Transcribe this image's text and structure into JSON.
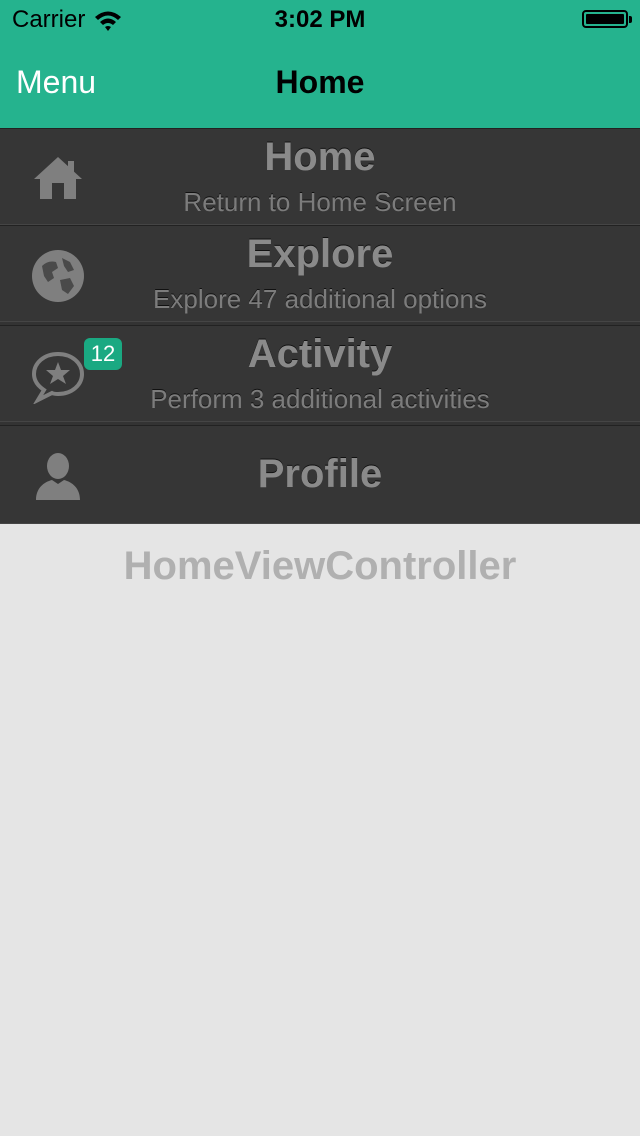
{
  "status": {
    "carrier": "Carrier",
    "time": "3:02 PM"
  },
  "nav": {
    "left_button": "Menu",
    "title": "Home"
  },
  "menu": {
    "items": [
      {
        "icon": "home-icon",
        "title": "Home",
        "subtitle": "Return to Home Screen"
      },
      {
        "icon": "globe-icon",
        "title": "Explore",
        "subtitle": "Explore 47 additional options"
      },
      {
        "icon": "chat-star-icon",
        "title": "Activity",
        "subtitle": "Perform 3 additional activities",
        "badge": "12"
      },
      {
        "icon": "person-icon",
        "title": "Profile",
        "subtitle": ""
      }
    ]
  },
  "content": {
    "label": "HomeViewController"
  },
  "colors": {
    "nav_background": "#25b38e",
    "menu_background": "#363636",
    "badge": "#1aa982",
    "content_background": "#e5e5e5"
  }
}
